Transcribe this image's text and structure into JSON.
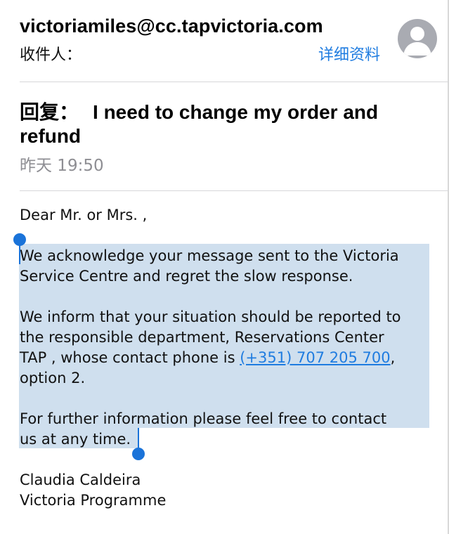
{
  "header": {
    "from_address": "victoriamiles@cc.tapvictoria.com",
    "to_label": "收件人：",
    "details_label": "详细资料"
  },
  "subject": {
    "prefix": "回复：",
    "title": "I need to change my order and refund"
  },
  "date": "昨天 19:50",
  "body": {
    "greeting": "Dear Mr. or Mrs. ,",
    "para1_line1": "We acknowledge your message sent to the Victoria",
    "para1_line2": "Service Centre and regret the slow response.",
    "para2_line1": "We inform that your situation should be reported to",
    "para2_line2": "the responsible department, Reservations Center",
    "para2_line3_pre": "TAP , whose contact phone is ",
    "phone": "(+351) 707 205 700",
    "para2_line3_post": ",",
    "para2_line4": "option 2.",
    "para3_line1": "For further information please feel free to contact",
    "para3_line2": "us at any time.",
    "signature_name": "Claudia Caldeira",
    "signature_org": "Victoria Programme"
  },
  "colors": {
    "link": "#1f7ce0",
    "selection": "#cfdfee",
    "handle": "#1a73d9",
    "avatar": "#a9abb2",
    "date_gray": "#8e8e93"
  },
  "icons": {
    "avatar": "person-avatar-icon"
  }
}
